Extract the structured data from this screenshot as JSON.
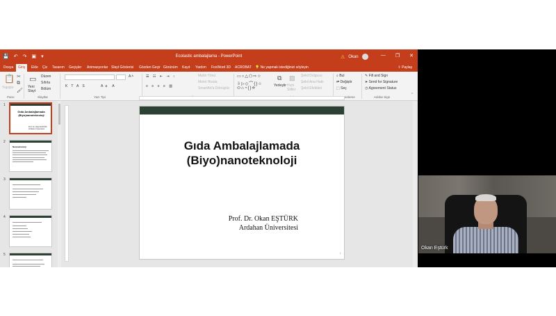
{
  "window": {
    "title": "Ecolastic ambalajlama - PowerPoint",
    "user": "Okan",
    "quick_access": [
      "💾",
      "↶",
      "↷",
      "▣",
      "▾"
    ],
    "win_controls": [
      "—",
      "❐",
      "✕"
    ]
  },
  "tabs": [
    {
      "label": "Dosya",
      "active": false
    },
    {
      "label": "Giriş",
      "active": true
    },
    {
      "label": "Ekle",
      "active": false
    },
    {
      "label": "Çiz",
      "active": false
    },
    {
      "label": "Tasarım",
      "active": false
    },
    {
      "label": "Geçişler",
      "active": false
    },
    {
      "label": "Animasyonlar",
      "active": false
    },
    {
      "label": "Slayt Gösterisi",
      "active": false
    },
    {
      "label": "Gözden Geçir",
      "active": false
    },
    {
      "label": "Görünüm",
      "active": false
    },
    {
      "label": "Kayıt",
      "active": false
    },
    {
      "label": "Yardım",
      "active": false
    },
    {
      "label": "FoxWord 3D",
      "active": false
    },
    {
      "label": "ACROBAT",
      "active": false
    }
  ],
  "tell_me": "Ne yapmak istediğinizi söyleyin",
  "share": "Paylaş",
  "ribbon": {
    "groups": [
      "Pano",
      "Slaytlar",
      "Yazı Tipi",
      "Paragraf",
      "Çizim",
      "Düzenleme",
      "Adobe Sign"
    ],
    "clipboard": {
      "paste": "Yapıştır"
    },
    "slides": {
      "new_slide": "Yeni Slayt",
      "layout": "Düzen",
      "reset": "Sıfırla",
      "section": "Bölüm"
    },
    "paragraph": {
      "text_direction": "Metin Yönü",
      "align_text": "Metni Hizala",
      "smartart": "SmartArt'a Dönüştür"
    },
    "drawing": {
      "arrange": "Yerleştir",
      "quick_styles": "Hızlı Stiller",
      "fill": "Şekil Dolgusu",
      "outline": "Şekil Ana Hattı",
      "effects": "Şekil Efektleri"
    },
    "editing": {
      "find": "Bul",
      "replace": "Değiştir",
      "select": "Seç"
    },
    "sign": {
      "fill_sign": "Fill and Sign",
      "send_sig": "Send for Signature",
      "agreement": "Agreement Status"
    }
  },
  "thumbnails": [
    {
      "num": "1",
      "title": "Gıda Ambalajlamada (Biyo)nanoteknoloji",
      "sub": "Prof. Dr. Okan EŞTÜRK\nArdahan Üniversitesi"
    },
    {
      "num": "2",
      "title": "Nanoteknoloji",
      "sub": ""
    },
    {
      "num": "3",
      "title": "",
      "sub": ""
    },
    {
      "num": "4",
      "title": "",
      "sub": ""
    },
    {
      "num": "5",
      "title": "",
      "sub": ""
    }
  ],
  "slide": {
    "title_line1": "Gıda Ambalajlamada",
    "title_line2": "(Biyo)nanoteknoloji",
    "author": "Prof. Dr.  Okan EŞTÜRK",
    "affiliation": "Ardahan Üniversitesi",
    "page": "1"
  },
  "webcam": {
    "name": "Okan Eştürk"
  },
  "colors": {
    "accent": "#c43e1c",
    "slide_header": "#2c4034"
  }
}
